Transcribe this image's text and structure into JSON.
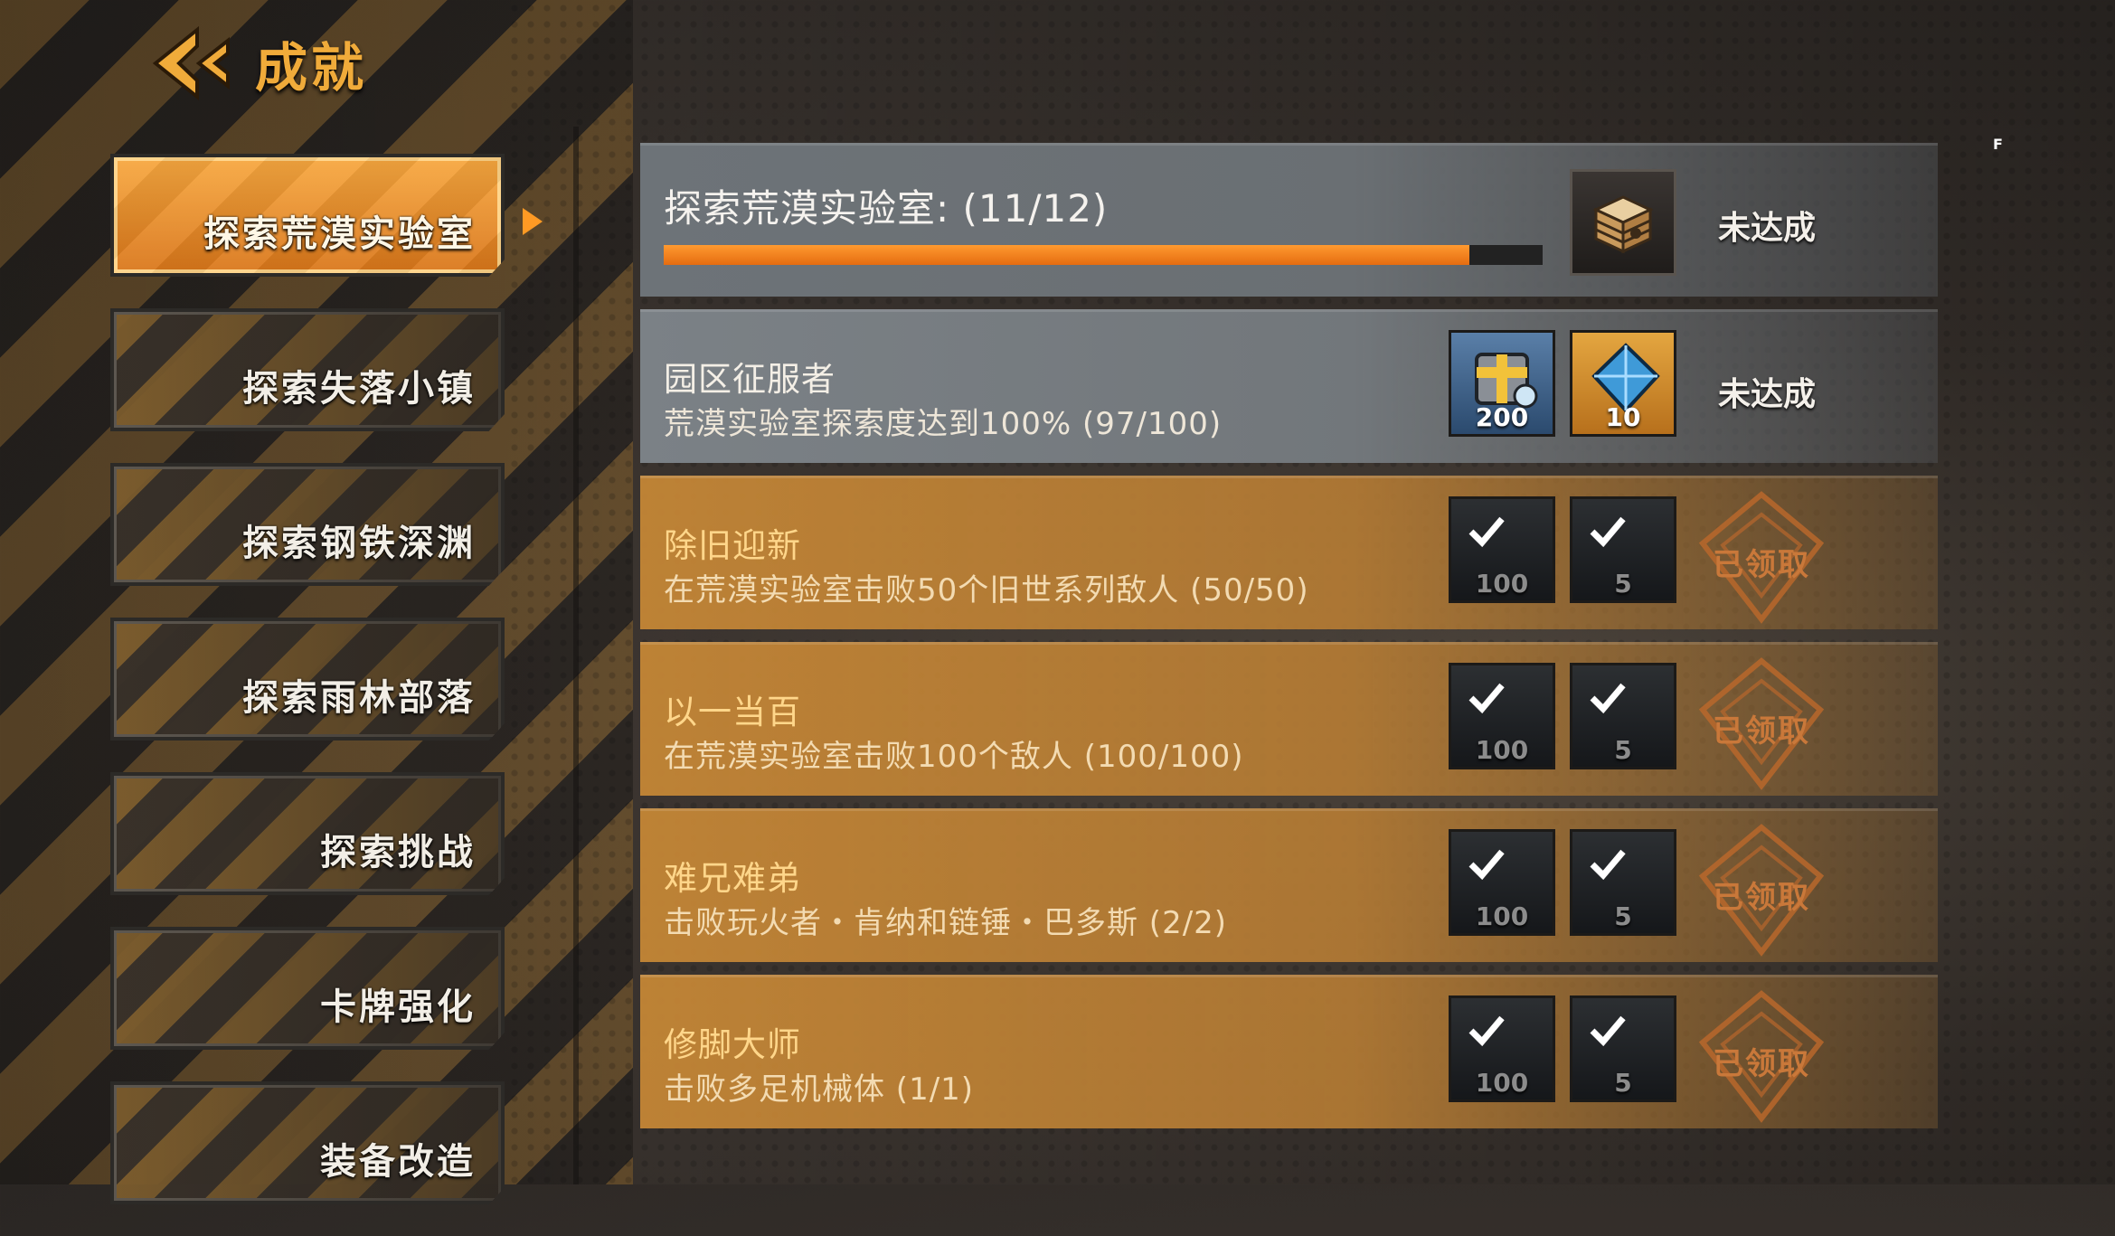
{
  "header": {
    "title": "成就"
  },
  "sidebar": {
    "items": [
      {
        "label": "探索荒漠实验室",
        "active": true
      },
      {
        "label": "探索失落小镇"
      },
      {
        "label": "探索钢铁深渊"
      },
      {
        "label": "探索雨林部落"
      },
      {
        "label": "探索挑战"
      },
      {
        "label": "卡牌强化"
      },
      {
        "label": "装备改造"
      }
    ]
  },
  "category": {
    "title": "探索荒漠实验室: (11/12)",
    "progress": 0.917,
    "status": "未达成",
    "badge_icon": "crate-icon"
  },
  "achievements": [
    {
      "title": "园区征服者",
      "desc": "荒漠实验室探索度达到100% (97/100)",
      "rewards": [
        "200",
        "10"
      ],
      "status": "未达成",
      "claimed": false
    },
    {
      "title": "除旧迎新",
      "desc": "在荒漠实验室击败50个旧世系列敌人 (50/50)",
      "rewards": [
        "100",
        "5"
      ],
      "status": "已领取",
      "claimed": true
    },
    {
      "title": "以一当百",
      "desc": "在荒漠实验室击败100个敌人 (100/100)",
      "rewards": [
        "100",
        "5"
      ],
      "status": "已领取",
      "claimed": true
    },
    {
      "title": "难兄难弟",
      "desc": "击败玩火者・肯纳和链锤・巴多斯 (2/2)",
      "rewards": [
        "100",
        "5"
      ],
      "status": "已领取",
      "claimed": true
    },
    {
      "title": "修脚大师",
      "desc": "击败多足机械体 (1/1)",
      "rewards": [
        "100",
        "5"
      ],
      "status": "已领取",
      "claimed": true
    }
  ],
  "corner_mark": "F",
  "colors": {
    "accent": "#f0ab3a",
    "progress": "#f28a22",
    "claimed_row": "#c4863a",
    "pending_row": "#767c81"
  }
}
